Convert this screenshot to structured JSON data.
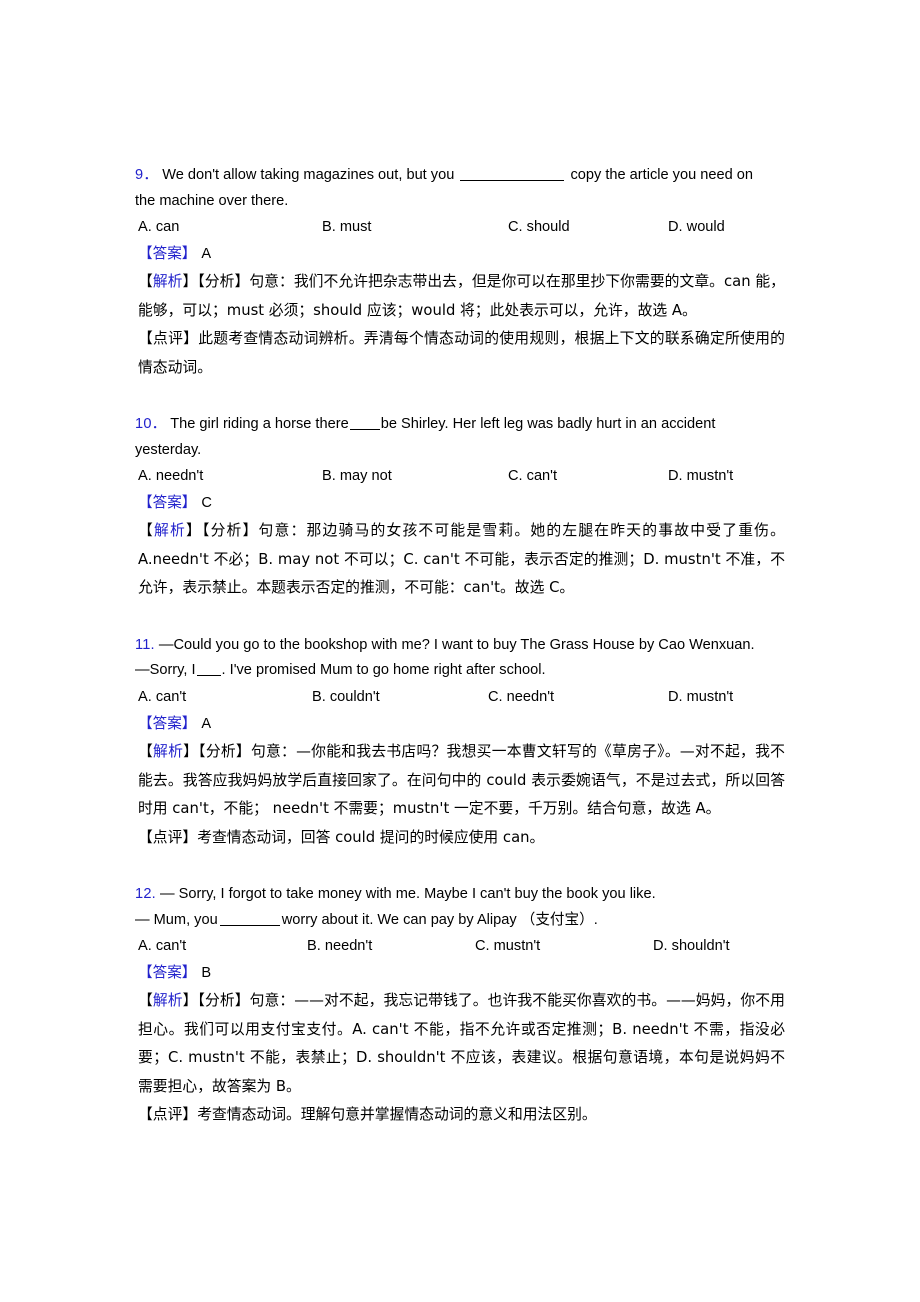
{
  "document": {
    "type": "english-exercise-answer-key",
    "page_background": "#ffffff",
    "accent_color": "#2222cc",
    "text_color": "#000000"
  },
  "labels": {
    "answer_tag": "【答案】",
    "analysis_tag_open": "【",
    "analysis_tag_word": "解析",
    "analysis_tag_close": "】",
    "fenxi_tag": "【分析】",
    "comment_tag": "【点评】"
  },
  "questions": [
    {
      "number": "9．",
      "stem_line1": "We don't allow taking magazines out, but you",
      "stem_line1_after": "copy the article you need on",
      "stem_line2": "the machine over there.",
      "blank_style": "long",
      "options": [
        {
          "key": "A",
          "label": "A. can"
        },
        {
          "key": "B",
          "label": "B. must"
        },
        {
          "key": "C",
          "label": "C. should"
        },
        {
          "key": "D",
          "label": "D. would"
        }
      ],
      "answer": "A",
      "analysis": "句意：我们不允许把杂志带出去，但是你可以在那里抄下你需要的文章。can 能，能够，可以；must 必须；should 应该；would 将；此处表示可以，允许，故选 A。",
      "comment": "此题考查情态动词辨析。弄清每个情态动词的使用规则，根据上下文的联系确定所使用的情态动词。"
    },
    {
      "number": "10．",
      "stem_line1": "The girl riding a horse there",
      "stem_line1_after": "be Shirley. Her left leg was badly hurt in an accident",
      "stem_line2": "yesterday.",
      "blank_style": "short",
      "options": [
        {
          "key": "A",
          "label": "A. needn't"
        },
        {
          "key": "B",
          "label": "B. may not"
        },
        {
          "key": "C",
          "label": "C. can't"
        },
        {
          "key": "D",
          "label": "D. mustn't"
        }
      ],
      "answer": "C",
      "analysis": "句意：那边骑马的女孩不可能是雪莉。她的左腿在昨天的事故中受了重伤。A.needn't 不必；B. may not 不可以；C. can't 不可能，表示否定的推测；D. mustn't 不准，不允许，表示禁止。本题表示否定的推测，不可能：can't。故选 C。",
      "comment": ""
    },
    {
      "number": "11.",
      "stem_line1": "—Could you go to the bookshop with me? I want to buy The Grass House by Cao Wenxuan.",
      "stem_line2_before": "—Sorry, I",
      "stem_line2_after": ". I've promised Mum to go home right after school.",
      "blank_style": "tiny",
      "options": [
        {
          "key": "A",
          "label": "A. can't"
        },
        {
          "key": "B",
          "label": "B. couldn't"
        },
        {
          "key": "C",
          "label": "C. needn't"
        },
        {
          "key": "D",
          "label": "D. mustn't"
        }
      ],
      "answer": "A",
      "analysis": "句意：—你能和我去书店吗？我想买一本曹文轩写的《草房子》。—对不起，我不能去。我答应我妈妈放学后直接回家了。在问句中的 could 表示委婉语气，不是过去式，所以回答时用 can't，不能； needn't 不需要；mustn't 一定不要，千万别。结合句意，故选 A。",
      "comment": "考查情态动词，回答 could 提问的时候应使用 can。"
    },
    {
      "number": "12.",
      "stem_line1": "— Sorry, I forgot to take money with me. Maybe I can't buy the book you like.",
      "stem_line2_before": "— Mum, you",
      "stem_line2_after": "worry about it. We can pay by Alipay （支付宝）.",
      "blank_style": "mid",
      "options": [
        {
          "key": "A",
          "label": "A. can't"
        },
        {
          "key": "B",
          "label": "B. needn't"
        },
        {
          "key": "C",
          "label": "C. mustn't"
        },
        {
          "key": "D",
          "label": "D. shouldn't"
        }
      ],
      "answer": "B",
      "analysis": "句意：——对不起，我忘记带钱了。也许我不能买你喜欢的书。——妈妈，你不用担心。我们可以用支付宝支付。A. can't 不能，指不允许或否定推测；B. needn't 不需，指没必要；C. mustn't 不能，表禁止；D. shouldn't 不应该，表建议。根据句意语境，本句是说妈妈不需要担心，故答案为 B。",
      "comment": "考查情态动词。理解句意并掌握情态动词的意义和用法区别。"
    }
  ]
}
